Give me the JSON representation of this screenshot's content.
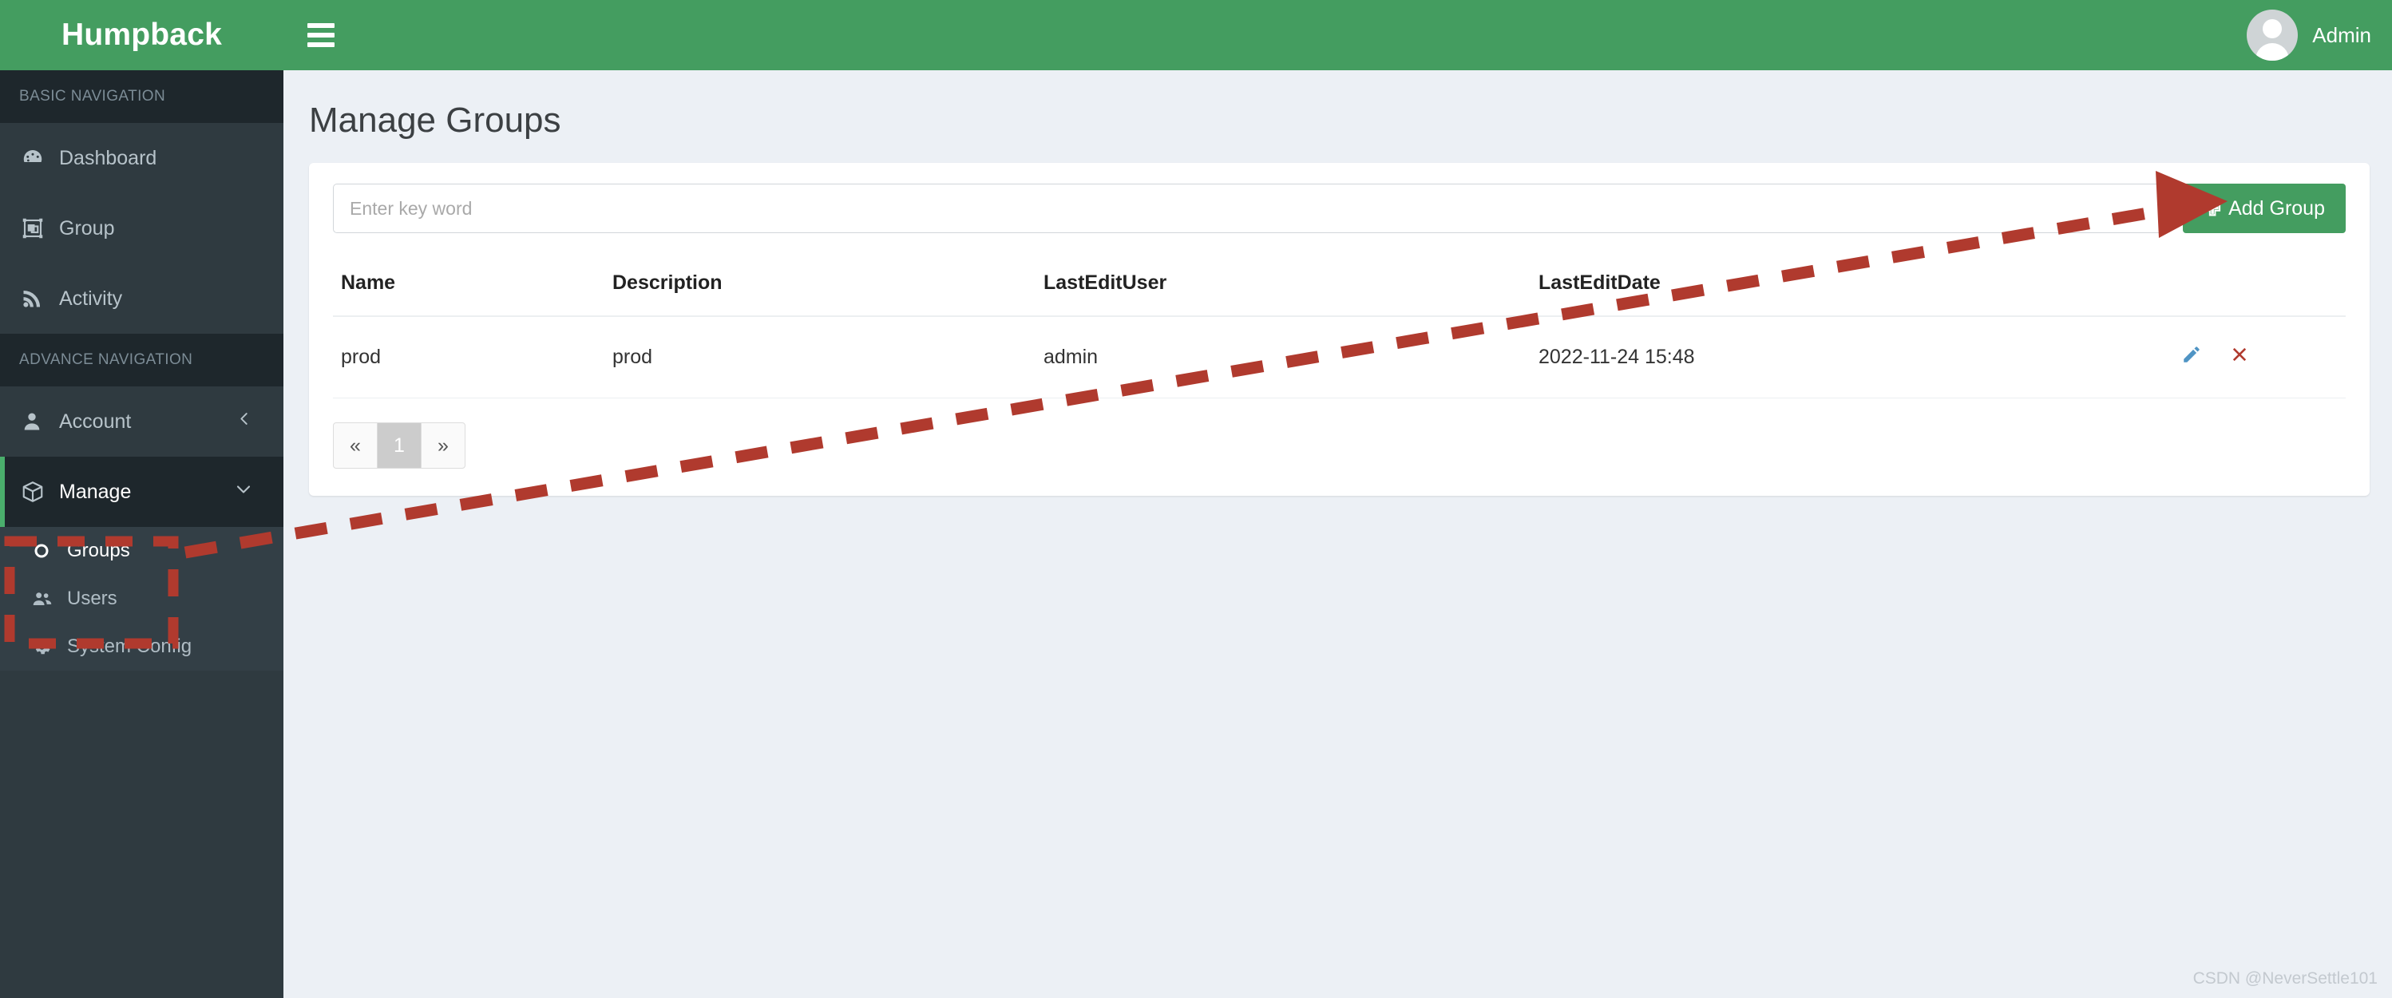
{
  "brand": {
    "title": "Humpback"
  },
  "topbar": {
    "menu_toggle": "hamburger",
    "user_name": "Admin"
  },
  "sidebar": {
    "sections": [
      {
        "label": "BASIC NAVIGATION",
        "items": [
          {
            "label": "Dashboard",
            "icon": "dashboard-icon"
          },
          {
            "label": "Group",
            "icon": "group-icon"
          },
          {
            "label": "Activity",
            "icon": "activity-rss-icon"
          }
        ]
      },
      {
        "label": "ADVANCE NAVIGATION",
        "items": [
          {
            "label": "Account",
            "icon": "user-icon",
            "caret": "‹"
          },
          {
            "label": "Manage",
            "icon": "box-icon",
            "caret": "⌄"
          }
        ]
      }
    ],
    "submenu": [
      {
        "label": "Groups",
        "icon": "circle-icon",
        "active": true
      },
      {
        "label": "Users",
        "icon": "users-icon",
        "active": false
      },
      {
        "label": "System Config",
        "icon": "gear-icon",
        "active": false
      }
    ]
  },
  "main": {
    "page_title": "Manage Groups",
    "search": {
      "value": "",
      "placeholder": "Enter key word"
    },
    "add_button": {
      "label": "Add Group",
      "icon": "plus-icon"
    },
    "table": {
      "columns": [
        "Name",
        "Description",
        "LastEditUser",
        "LastEditDate",
        ""
      ],
      "rows": [
        {
          "name": "prod",
          "description": "prod",
          "last_edit_user": "admin",
          "last_edit_date": "2022-11-24 15:48",
          "edit_icon": "pencil-icon",
          "delete_icon": "x-close-icon"
        }
      ]
    },
    "pagination": {
      "prev": "«",
      "pages": [
        "1"
      ],
      "next": "»",
      "current": "1"
    }
  },
  "watermark": {
    "text": "CSDN @NeverSettle101"
  },
  "colors": {
    "brand_green": "#449d60",
    "sidebar_dark": "#2f3a40",
    "sidebar_section": "#1e272c",
    "submenu_bg": "#333f46",
    "page_bg": "#ecf0f5",
    "annotation_red": "#b03a2e",
    "edit_blue": "#4f94c4"
  }
}
